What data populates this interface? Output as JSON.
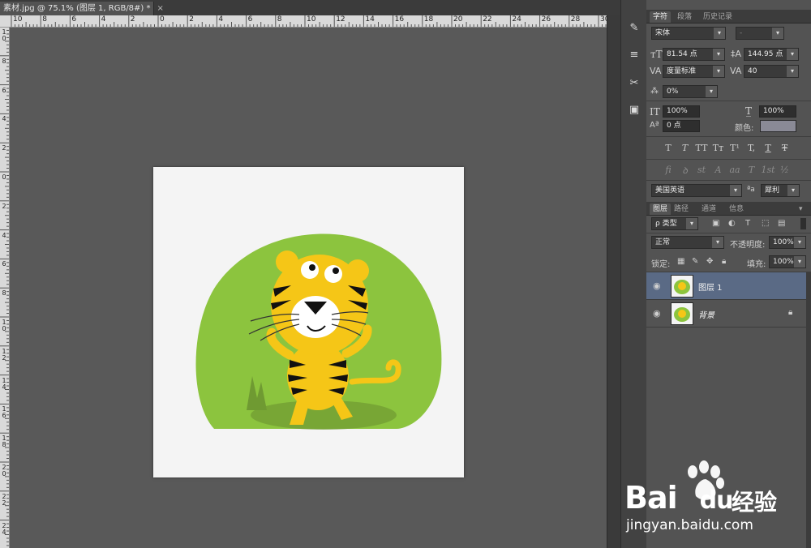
{
  "document": {
    "tab_title": "素材.jpg @ 75.1% (图层 1, RGB/8#) *",
    "close_symbol": "×"
  },
  "rulers": {
    "top": [
      "10",
      "8",
      "6",
      "4",
      "2",
      "0",
      "2",
      "4",
      "6",
      "8",
      "10",
      "12",
      "14",
      "16",
      "18",
      "20",
      "22",
      "24",
      "26",
      "28",
      "30"
    ],
    "left": [
      "10",
      "8",
      "6",
      "4",
      "2",
      "0",
      "2",
      "4",
      "6",
      "8",
      "10",
      "12",
      "14",
      "16",
      "18",
      "20",
      "22",
      "24"
    ]
  },
  "character_panel": {
    "tabs": [
      "字符",
      "段落",
      "历史记录"
    ],
    "font_family": "宋体",
    "font_style": "-",
    "font_size": "81.54 点",
    "leading": "144.95 点",
    "kerning": "度量标准",
    "tracking": "40",
    "tsume": "0%",
    "vertical_scale": "100%",
    "horizontal_scale": "100%",
    "baseline_shift": "0 点",
    "color_label": "颜色:",
    "color_value": "#8a8a96",
    "type_buttons": [
      "T",
      "T",
      "TT",
      "Tт",
      "T¹",
      "T,",
      "T",
      "Ŧ"
    ],
    "opentype_buttons": [
      "fi",
      "ꝺ",
      "st",
      "A",
      "aa",
      "T",
      "1st",
      "½"
    ],
    "language": "美国英语",
    "aa_label": "ªa",
    "antialias": "犀利"
  },
  "layers_panel": {
    "tabs": [
      "图层",
      "路径",
      "通道",
      "信息"
    ],
    "filter_kind": "ρ 类型",
    "blend_mode": "正常",
    "opacity_label": "不透明度:",
    "opacity": "100%",
    "lock_label": "锁定:",
    "fill_label": "填充:",
    "fill": "100%",
    "layers": [
      {
        "name": "图层 1",
        "selected": true,
        "locked": false
      },
      {
        "name": "背景",
        "selected": false,
        "locked": true
      }
    ]
  },
  "watermark": {
    "brand": "Bai",
    "brand_end": "du",
    "service": "经验",
    "url": "jingyan.baidu.com"
  },
  "colors": {
    "selection": "#5a6a85",
    "blob_green": "#8cc43e",
    "tiger_yellow": "#f5c617"
  }
}
